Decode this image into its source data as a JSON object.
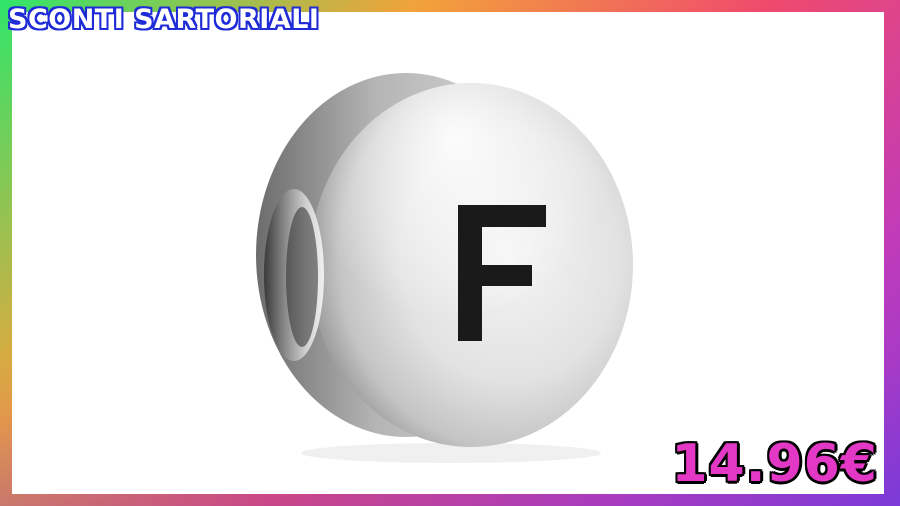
{
  "banner": {
    "brand_text": "SCONTI SARTORIALI",
    "price": "14.96€"
  },
  "product": {
    "name": "letter-bead-charm",
    "engraved_letter": "F"
  },
  "colors": {
    "brand_fill": "#ffffff",
    "brand_outline": "#1f2bd6",
    "price_fill": "#e238c5",
    "price_outline": "#000000",
    "frame_gradient": [
      "#2ee66a",
      "#f2a23a",
      "#ef4a6d",
      "#c23bb8",
      "#8a3ad6"
    ]
  }
}
